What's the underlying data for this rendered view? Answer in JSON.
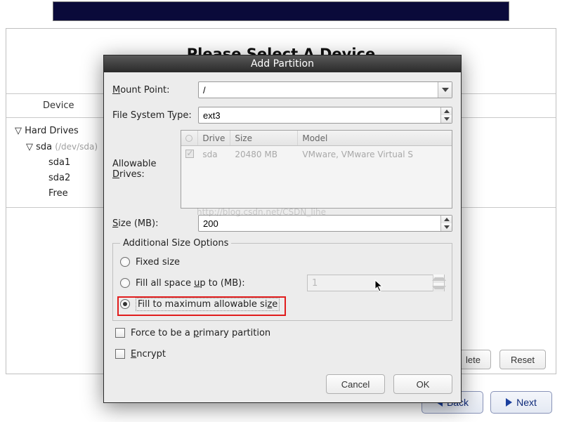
{
  "topband": {},
  "background": {
    "heading": "Please Select A Device",
    "device_header": "Device",
    "tree": {
      "root": "Hard Drives",
      "disk": "sda",
      "disk_dev": "(/dev/sda)",
      "children": [
        "sda1",
        "sda2",
        "Free"
      ]
    },
    "delete_button_partial": "lete",
    "reset_button": "Reset"
  },
  "nav": {
    "back": "Back",
    "next": "Next"
  },
  "modal": {
    "title": "Add Partition",
    "mount_point_label": "Mount Point:",
    "mount_point_value": "/",
    "fs_type_label": "File System Type:",
    "fs_type_value": "ext3",
    "allowable_drives_label": "Allowable Drives:",
    "drive_table": {
      "columns": [
        "",
        "Drive",
        "Size",
        "Model"
      ],
      "rows": [
        {
          "checked": true,
          "drive": "sda",
          "size": "20480 MB",
          "model": "VMware, VMware Virtual S"
        }
      ]
    },
    "size_label": "Size (MB):",
    "size_value": "200",
    "watermark": "http://blog.csdn.net/CSDN_lihe",
    "options_legend": "Additional Size Options",
    "radio_fixed": "Fixed size",
    "radio_fill_up_to": "Fill all space up to (MB):",
    "fill_up_to_value": "1",
    "radio_fill_max": "Fill to maximum allowable size",
    "selected_option": "fill_max",
    "force_primary": "Force to be a primary partition",
    "encrypt": "Encrypt",
    "cancel": "Cancel",
    "ok": "OK"
  }
}
